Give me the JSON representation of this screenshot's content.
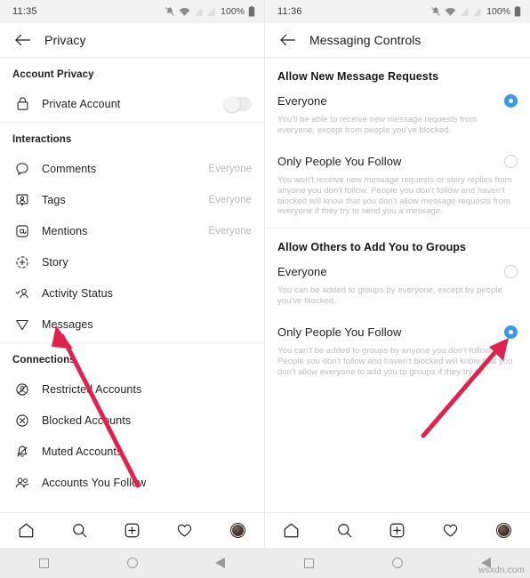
{
  "left": {
    "statusbar": {
      "time": "11:35",
      "battery": "100%"
    },
    "appbar": {
      "title": "Privacy",
      "back_icon": "back-arrow-icon"
    },
    "sections": [
      {
        "header": "Account Privacy",
        "rows": [
          {
            "icon": "lock-icon",
            "label": "Private Account",
            "control": "toggle",
            "value": ""
          }
        ]
      },
      {
        "header": "Interactions",
        "rows": [
          {
            "icon": "comment-bubble-icon",
            "label": "Comments",
            "control": "value",
            "value": "Everyone"
          },
          {
            "icon": "tag-icon",
            "label": "Tags",
            "control": "value",
            "value": "Everyone"
          },
          {
            "icon": "mention-at-icon",
            "label": "Mentions",
            "control": "value",
            "value": "Everyone"
          },
          {
            "icon": "story-plus-icon",
            "label": "Story",
            "control": "none",
            "value": ""
          },
          {
            "icon": "activity-status-icon",
            "label": "Activity Status",
            "control": "none",
            "value": ""
          },
          {
            "icon": "messages-paperplane-icon",
            "label": "Messages",
            "control": "none",
            "value": ""
          }
        ]
      },
      {
        "header": "Connections",
        "rows": [
          {
            "icon": "restricted-accounts-icon",
            "label": "Restricted Accounts",
            "control": "none",
            "value": ""
          },
          {
            "icon": "blocked-accounts-icon",
            "label": "Blocked Accounts",
            "control": "none",
            "value": ""
          },
          {
            "icon": "muted-accounts-icon",
            "label": "Muted Accounts",
            "control": "none",
            "value": ""
          },
          {
            "icon": "accounts-you-follow-icon",
            "label": "Accounts You Follow",
            "control": "none",
            "value": ""
          }
        ]
      }
    ]
  },
  "right": {
    "statusbar": {
      "time": "11:36",
      "battery": "100%"
    },
    "appbar": {
      "title": "Messaging Controls",
      "back_icon": "back-arrow-icon"
    },
    "groups": [
      {
        "header": "Allow New Message Requests",
        "options": [
          {
            "label": "Everyone",
            "selected": true,
            "desc": "You'll be able to receive new message requests from everyone, except from people you've blocked."
          },
          {
            "label": "Only People You Follow",
            "selected": false,
            "desc": "You won't receive new message requests or story replies from anyone you don't follow. People you don't follow and haven't blocked will know that you don't allow message requests from everyone if they try to send you a message."
          }
        ]
      },
      {
        "header": "Allow Others to Add You to Groups",
        "options": [
          {
            "label": "Everyone",
            "selected": false,
            "desc": "You can be added to groups by everyone, except by people you've blocked."
          },
          {
            "label": "Only People You Follow",
            "selected": true,
            "desc": "You can't be added to groups by anyone you don't follow. People you don't follow and haven't blocked will know that you don't allow everyone to add you to groups if they try to."
          }
        ]
      }
    ]
  },
  "tabbar": {
    "items": [
      {
        "icon": "home-icon",
        "label": "Home"
      },
      {
        "icon": "search-icon",
        "label": "Search"
      },
      {
        "icon": "add-post-icon",
        "label": "Add"
      },
      {
        "icon": "heart-activity-icon",
        "label": "Activity"
      },
      {
        "icon": "profile-avatar-icon",
        "label": "Profile"
      }
    ]
  },
  "navbar": {
    "items": [
      {
        "icon": "recents-square-icon",
        "label": "Recents"
      },
      {
        "icon": "home-circle-icon",
        "label": "Home"
      },
      {
        "icon": "back-triangle-icon",
        "label": "Back"
      }
    ]
  },
  "annotations": {
    "arrow_color": "#E0224E",
    "arrow_left_target": "Messages",
    "arrow_right_target": "Only People You Follow radio"
  },
  "watermark": "wsxdn.com"
}
